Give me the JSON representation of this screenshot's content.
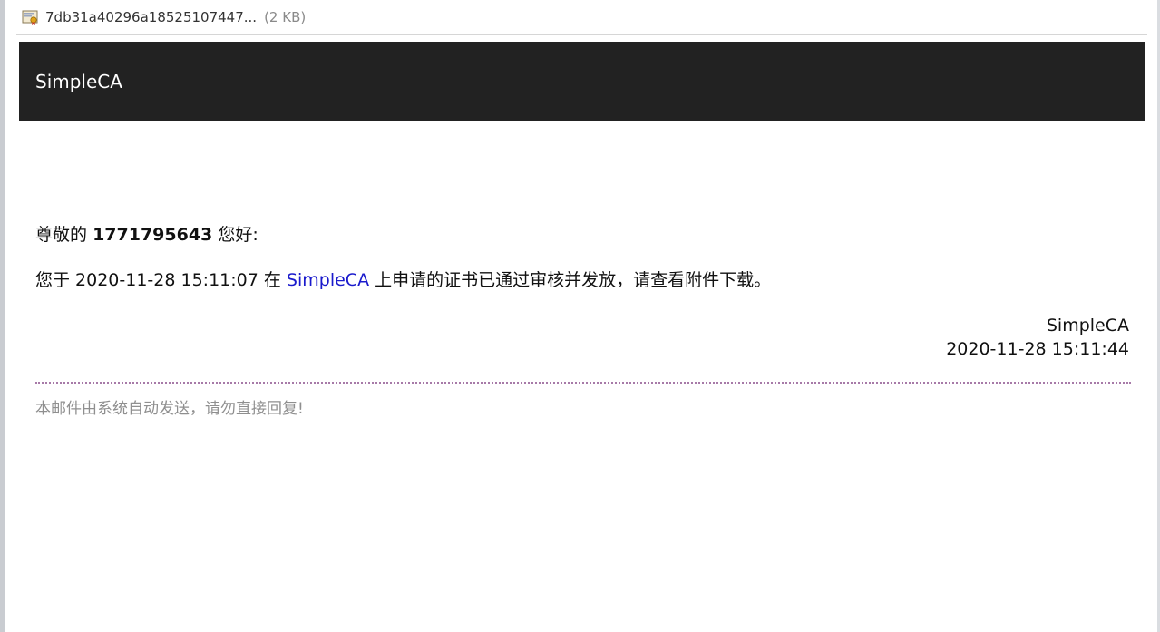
{
  "attachment": {
    "name": "7db31a40296a18525107447...",
    "size": "(2 KB)",
    "icon": "certificate-file-icon"
  },
  "header": {
    "brand": "SimpleCA",
    "background": "#222222"
  },
  "body": {
    "greeting_prefix": "尊敬的",
    "user_id": "1771795643",
    "greeting_suffix": "您好:",
    "message_prefix": "您于 2020-11-28 15:11:07 在",
    "message_link": "SimpleCA",
    "message_suffix": "上申请的证书已通过审核并发放，请查看附件下载。",
    "link_color": "#1a1acc"
  },
  "signature": {
    "sender": "SimpleCA",
    "timestamp": "2020-11-28 15:11:44"
  },
  "footer": {
    "note": "本邮件由系统自动发送，请勿直接回复!"
  }
}
